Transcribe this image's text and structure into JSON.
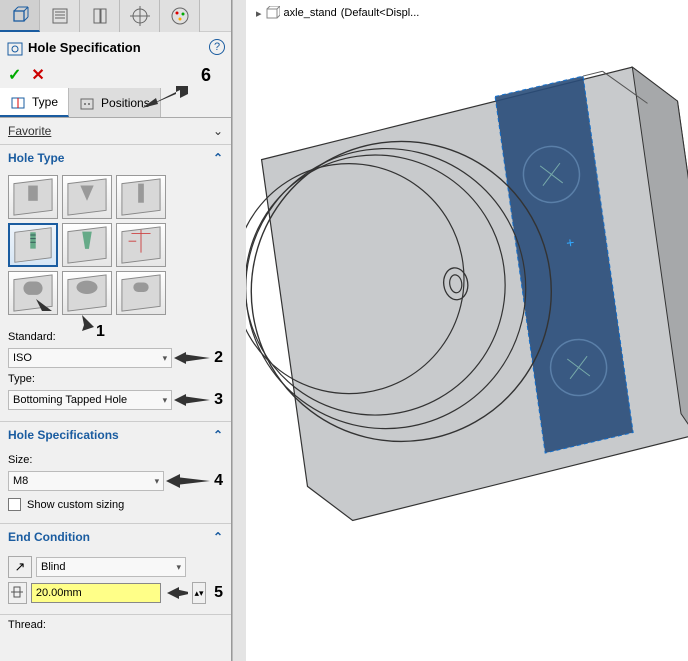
{
  "breadcrumb": {
    "part_name": "axle_stand",
    "config": "(Default<Displ..."
  },
  "panel": {
    "title": "Hole Specification",
    "tabs": {
      "type": "Type",
      "positions": "Positions"
    },
    "favorite_header": "Favorite",
    "hole_type": {
      "header": "Hole Type",
      "standard_label": "Standard:",
      "standard_value": "ISO",
      "type_label": "Type:",
      "type_value": "Bottoming Tapped Hole"
    },
    "hole_spec": {
      "header": "Hole Specifications",
      "size_label": "Size:",
      "size_value": "M8",
      "custom_sizing": "Show custom sizing"
    },
    "end_cond": {
      "header": "End Condition",
      "mode": "Blind",
      "depth": "20.00mm"
    },
    "thread_header": "Thread:"
  },
  "callouts": {
    "c1": "1",
    "c2": "2",
    "c3": "3",
    "c4": "4",
    "c5": "5",
    "c6": "6"
  }
}
